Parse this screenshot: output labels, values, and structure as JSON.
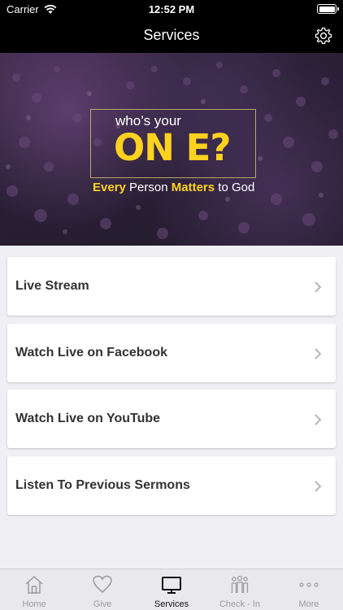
{
  "status_bar": {
    "carrier": "Carrier",
    "time": "12:52 PM"
  },
  "nav": {
    "title": "Services"
  },
  "banner": {
    "line1": "who’s your",
    "line2": "ON E?",
    "tag_1": "Every",
    "tag_2": " Person ",
    "tag_3": "Matters",
    "tag_4": " to God"
  },
  "items": [
    {
      "label": "Live Stream"
    },
    {
      "label": "Watch Live on Facebook"
    },
    {
      "label": "Watch Live on YouTube"
    },
    {
      "label": "Listen To Previous Sermons"
    }
  ],
  "tabs": [
    {
      "label": "Home",
      "icon": "home-icon"
    },
    {
      "label": "Give",
      "icon": "heart-icon"
    },
    {
      "label": "Services",
      "icon": "tv-icon",
      "active": true
    },
    {
      "label": "Check - In",
      "icon": "people-icon"
    },
    {
      "label": "More",
      "icon": "more-dots-icon"
    }
  ],
  "colors": {
    "nav_bg": "#000000",
    "accent_yellow": "#ffd21f",
    "tab_inactive": "#9b9ba0"
  }
}
